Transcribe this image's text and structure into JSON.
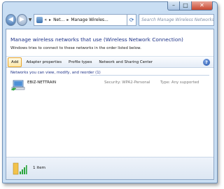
{
  "window": {
    "controls": {
      "minimize": "–",
      "maximize": "□",
      "close": "✕"
    }
  },
  "nav": {
    "back_glyph": "◀",
    "forward_glyph": "▶",
    "dropdown_glyph": "▼",
    "breadcrumb": [
      "Net...",
      "Manage Wireles..."
    ],
    "breadcrumb_prefix": "«",
    "breadcrumb_sep": "▸",
    "refresh_glyph": "⟳",
    "search_placeholder": "Search Manage Wireless Networks",
    "search_icon": "magnifier-icon"
  },
  "main": {
    "title": "Manage wireless networks that use (Wireless Network Connection)",
    "subtitle": "Windows tries to connect to these networks in the order listed below."
  },
  "toolbar": {
    "add_label": "Add",
    "adapter_label": "Adapter properties",
    "profile_label": "Profile types",
    "network_center_label": "Network and Sharing Center",
    "help_label": "?"
  },
  "networks": {
    "group_header": "Networks you can view, modify, and reorder (1)",
    "items": [
      {
        "name": "EBIZ-NETTRAIN",
        "security": "Security:  WPA2-Personal",
        "type": "Type:  Any supported",
        "icon": "wireless-network-icon"
      }
    ]
  },
  "details": {
    "count_text": "1 item",
    "icon": "wireless-signal-icon"
  },
  "colors": {
    "accent_highlight": "#e7a32a",
    "heading_blue": "#1e3287"
  }
}
